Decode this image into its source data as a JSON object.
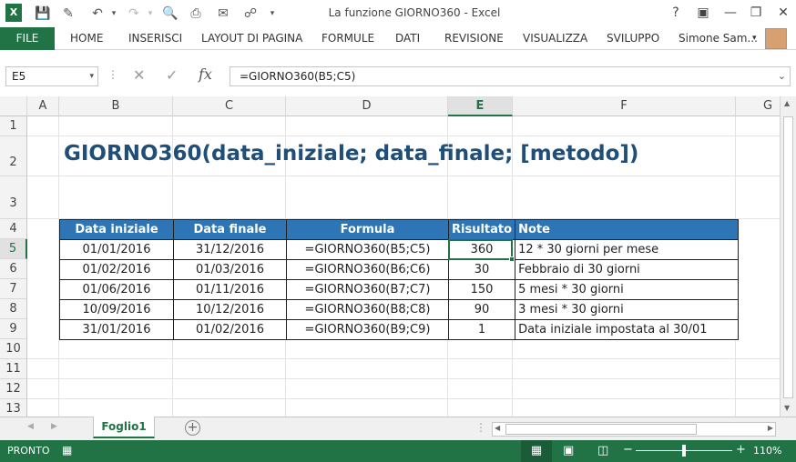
{
  "window": {
    "title": "La funzione GIORNO360 - Excel",
    "help": "?"
  },
  "ribbon": {
    "file": "FILE",
    "tabs": [
      "HOME",
      "INSERISCI",
      "LAYOUT DI PAGINA",
      "FORMULE",
      "DATI",
      "REVISIONE",
      "VISUALIZZA",
      "SVILUPPO"
    ],
    "user": "Simone Sam..."
  },
  "formula_bar": {
    "name_box": "E5",
    "fx": "fx",
    "formula": "=GIORNO360(B5;C5)"
  },
  "columns": [
    "A",
    "B",
    "C",
    "D",
    "E",
    "F",
    "G"
  ],
  "rows": [
    "1",
    "2",
    "3",
    "4",
    "5",
    "6",
    "7",
    "8",
    "9",
    "10",
    "11",
    "12",
    "13"
  ],
  "sheet": {
    "title": "GIORNO360(data_iniziale; data_finale; [metodo])",
    "table": {
      "headers": [
        "Data iniziale",
        "Data finale",
        "Formula",
        "Risultato",
        "Note"
      ],
      "rows": [
        [
          "01/01/2016",
          "31/12/2016",
          "=GIORNO360(B5;C5)",
          "360",
          "12 * 30 giorni per mese"
        ],
        [
          "01/02/2016",
          "01/03/2016",
          "=GIORNO360(B6;C6)",
          "30",
          "Febbraio di 30 giorni"
        ],
        [
          "01/06/2016",
          "01/11/2016",
          "=GIORNO360(B7;C7)",
          "150",
          "5 mesi * 30 giorni"
        ],
        [
          "10/09/2016",
          "10/12/2016",
          "=GIORNO360(B8;C8)",
          "90",
          "3 mesi * 30 giorni"
        ],
        [
          "31/01/2016",
          "01/02/2016",
          "=GIORNO360(B9;C9)",
          "1",
          "Data iniziale impostata al 30/01"
        ]
      ]
    }
  },
  "sheet_tabs": {
    "active": "Foglio1"
  },
  "status_bar": {
    "state": "PRONTO",
    "zoom": "110%"
  },
  "colors": {
    "excel_green": "#217346",
    "header_blue": "#2e75b6",
    "title_blue": "#1f4e79"
  }
}
